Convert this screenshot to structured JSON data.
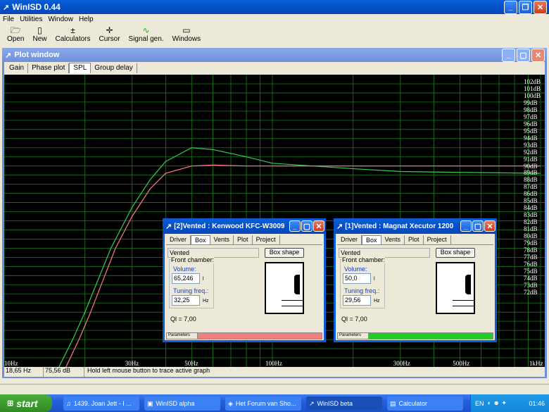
{
  "app": {
    "title": "WinISD 0.44"
  },
  "menu": [
    "File",
    "Utilities",
    "Window",
    "Help"
  ],
  "toolbar": [
    {
      "label": "Open",
      "icon": "folder-icon"
    },
    {
      "label": "New",
      "icon": "new-doc-icon"
    },
    {
      "label": "Calculators",
      "icon": "calculator-icon"
    },
    {
      "label": "Cursor",
      "icon": "cursor-icon"
    },
    {
      "label": "Signal gen.",
      "icon": "signal-icon"
    },
    {
      "label": "Windows",
      "icon": "windows-icon"
    }
  ],
  "plot": {
    "title": "Plot window",
    "tabs": [
      "Gain",
      "Phase plot",
      "SPL",
      "Group delay"
    ],
    "active_tab": "SPL",
    "y_labels": [
      "102dB",
      "101dB",
      "100dB",
      "99dB",
      "98dB",
      "97dB",
      "96dB",
      "95dB",
      "94dB",
      "93dB",
      "92dB",
      "91dB",
      "90dB",
      "89dB",
      "88dB",
      "87dB",
      "86dB",
      "85dB",
      "84dB",
      "83dB",
      "82dB",
      "81dB",
      "80dB",
      "79dB",
      "78dB",
      "77dB",
      "76dB",
      "75dB",
      "74dB",
      "73dB",
      "72dB"
    ],
    "x_labels": [
      "10Hz",
      "30Hz",
      "50Hz",
      "100Hz",
      "300Hz",
      "500Hz",
      "1kHz"
    ],
    "status": {
      "freq": "18,65 Hz",
      "level": "75,56 dB",
      "hint": "Hold left mouse button to trace active graph"
    }
  },
  "chart_data": {
    "type": "line",
    "xlabel": "",
    "ylabel": "",
    "xscale": "log",
    "xlim": [
      10,
      1000
    ],
    "ylim": [
      71,
      103
    ],
    "series": [
      {
        "color": "#33cc55",
        "x": [
          16,
          18,
          20,
          22,
          25,
          30,
          35,
          40,
          50,
          60,
          80,
          100,
          200,
          300,
          500,
          1000
        ],
        "y": [
          71,
          74,
          77,
          80,
          84,
          88.5,
          91.5,
          93.5,
          95,
          94.8,
          94,
          93.3,
          92.7,
          92.4,
          92.3,
          92.2
        ]
      },
      {
        "color": "#ff7a8a",
        "x": [
          17,
          19,
          21,
          23,
          26,
          30,
          35,
          40,
          50,
          60,
          80,
          100,
          200,
          300,
          500,
          1000
        ],
        "y": [
          71,
          74,
          77,
          80,
          84,
          87.5,
          90.5,
          92.2,
          93,
          93.1,
          93,
          93,
          93,
          93,
          93,
          93
        ]
      }
    ],
    "grid": true
  },
  "dialogs": [
    {
      "title": "[2]Vented : Kenwood KFC-W3009",
      "tabs": [
        "Driver",
        "Box",
        "Vents",
        "Plot",
        "Project"
      ],
      "active_tab": "Box",
      "type": "Vented",
      "box_shape": "Box shape",
      "front_chamber": "Front chamber:",
      "volume_label": "Volume:",
      "volume": "65,246",
      "volume_unit": "l",
      "tuning_label": "Tuning freq.:",
      "tuning": "32,25",
      "tuning_unit": "Hz",
      "ql": "Ql = 7,00",
      "params": "Parameters",
      "color": "#f08080"
    },
    {
      "title": "[1]Vented : Magnat Xecutor 1200",
      "tabs": [
        "Driver",
        "Box",
        "Vents",
        "Plot",
        "Project"
      ],
      "active_tab": "Box",
      "type": "Vented",
      "box_shape": "Box shape",
      "front_chamber": "Front chamber:",
      "volume_label": "Volume:",
      "volume": "50,0",
      "volume_unit": "l",
      "tuning_label": "Tuning freq.:",
      "tuning": "29,56",
      "tuning_unit": "Hz",
      "ql": "Ql = 7,00",
      "params": "Parameters",
      "color": "#22cc22"
    }
  ],
  "taskbar": {
    "start": "start",
    "items": [
      "1439. Joan Jett - I ...",
      "WinISD alpha",
      "Het Forum van Sho...",
      "WinISD beta",
      "Calculator"
    ],
    "lang": "EN",
    "clock": "01:46"
  }
}
